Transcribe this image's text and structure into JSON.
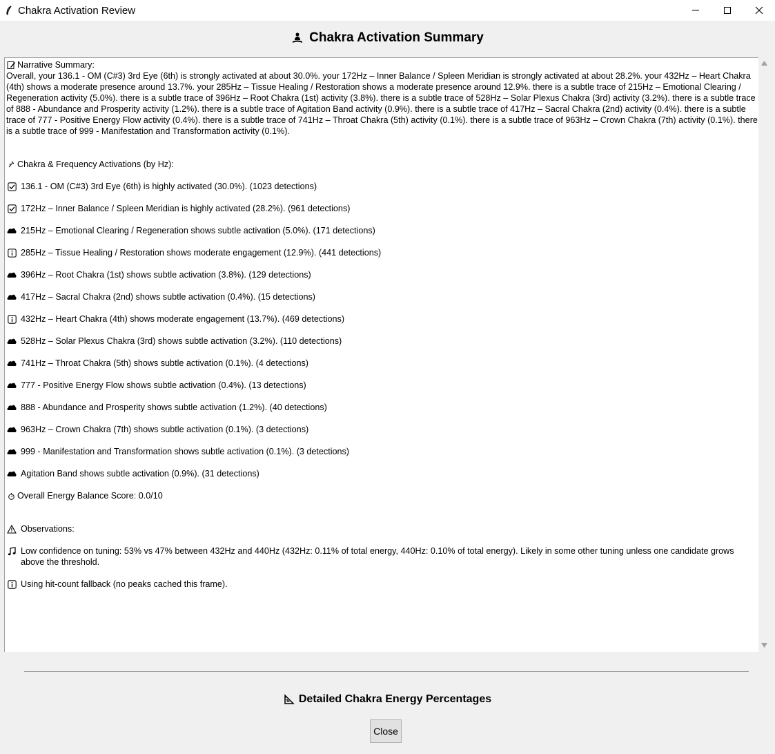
{
  "window": {
    "title": "Chakra Activation Review",
    "icon": "feather-icon",
    "controls": [
      "minimize-icon",
      "maximize-icon",
      "close-icon"
    ]
  },
  "header": {
    "title": "Chakra Activation Summary",
    "icon": "meditation-icon"
  },
  "narrative": {
    "heading": "Narrative Summary:",
    "icon": "memo-icon",
    "text": "Overall, your 136.1 - OM (C#3) 3rd Eye (6th) is strongly activated at about 30.0%. your 172Hz – Inner Balance / Spleen Meridian is strongly activated at about 28.2%. your 432Hz – Heart Chakra (4th) shows a moderate presence around 13.7%. your 285Hz – Tissue Healing / Restoration shows a moderate presence around 12.9%. there is a subtle trace of 215Hz – Emotional Clearing / Regeneration activity (5.0%). there is a subtle trace of 396Hz – Root Chakra (1st) activity (3.8%). there is a subtle trace of 528Hz – Solar Plexus Chakra (3rd) activity (3.2%). there is a subtle trace of 888 - Abundance and Prosperity activity (1.2%). there is a subtle trace of Agitation Band activity (0.9%). there is a subtle trace of 417Hz – Sacral Chakra (2nd) activity (0.4%). there is a subtle trace of 777 - Positive Energy Flow activity (0.4%). there is a subtle trace of 741Hz – Throat Chakra (5th) activity (0.1%). there is a subtle trace of 963Hz – Crown Chakra (7th) activity (0.1%). there is a subtle trace of 999 - Manifestation and Transformation activity (0.1%)."
  },
  "activations": {
    "heading": "Chakra & Frequency Activations (by Hz):",
    "icon": "sparkle-icon",
    "items": [
      {
        "icon": "checkbox-checked-icon",
        "text": "136.1 - OM (C#3) 3rd Eye (6th) is highly activated (30.0%). (1023 detections)"
      },
      {
        "icon": "checkbox-checked-icon",
        "text": "172Hz – Inner Balance / Spleen Meridian is highly activated (28.2%). (961 detections)"
      },
      {
        "icon": "cloud-icon",
        "text": "215Hz – Emotional Clearing / Regeneration shows subtle activation (5.0%). (171 detections)"
      },
      {
        "icon": "info-icon",
        "text": "285Hz – Tissue Healing / Restoration shows moderate engagement (12.9%). (441 detections)"
      },
      {
        "icon": "cloud-icon",
        "text": "396Hz – Root Chakra (1st) shows subtle activation (3.8%). (129 detections)"
      },
      {
        "icon": "cloud-icon",
        "text": "417Hz – Sacral Chakra (2nd) shows subtle activation (0.4%). (15 detections)"
      },
      {
        "icon": "info-icon",
        "text": "432Hz – Heart Chakra (4th) shows moderate engagement (13.7%). (469 detections)"
      },
      {
        "icon": "cloud-icon",
        "text": "528Hz – Solar Plexus Chakra (3rd) shows subtle activation (3.2%). (110 detections)"
      },
      {
        "icon": "cloud-icon",
        "text": "741Hz – Throat Chakra (5th) shows subtle activation (0.1%). (4 detections)"
      },
      {
        "icon": "cloud-icon",
        "text": "777 - Positive Energy Flow shows subtle activation (0.4%). (13 detections)"
      },
      {
        "icon": "cloud-icon",
        "text": "888 - Abundance and Prosperity shows subtle activation (1.2%). (40 detections)"
      },
      {
        "icon": "cloud-icon",
        "text": "963Hz – Crown Chakra (7th) shows subtle activation (0.1%). (3 detections)"
      },
      {
        "icon": "cloud-icon",
        "text": "999 - Manifestation and Transformation shows subtle activation (0.1%). (3 detections)"
      },
      {
        "icon": "cloud-icon",
        "text": "Agitation Band shows subtle activation (0.9%). (31 detections)"
      }
    ]
  },
  "balance": {
    "icon": "stopwatch-icon",
    "text": "Overall Energy Balance Score: 0.0/10"
  },
  "observations": {
    "heading": "Observations:",
    "icon": "warning-icon",
    "items": [
      {
        "icon": "music-note-icon",
        "text": "Low confidence on tuning: 53% vs 47% between 432Hz and 440Hz (432Hz: 0.11% of total energy, 440Hz: 0.10% of total energy). Likely in some other tuning unless one candidate grows above the threshold."
      },
      {
        "icon": "info-icon",
        "text": "Using hit-count fallback (no peaks cached this frame)."
      }
    ]
  },
  "details": {
    "title": "Detailed Chakra Energy Percentages",
    "icon": "triangle-ruler-icon"
  },
  "close_button": {
    "label": "Close"
  }
}
